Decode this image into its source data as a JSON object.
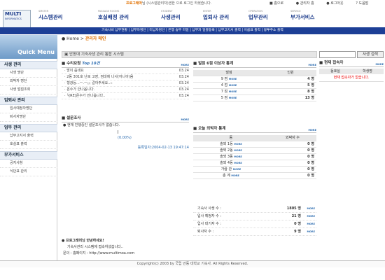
{
  "header": {
    "welcome_name": "프로그래머",
    "welcome_text": "님 (시스템관리자)권한 으로 로그인 하셨습니다.",
    "links": [
      "홈으로",
      "관리자 홈",
      "로그아웃",
      "도움말"
    ],
    "logo_text": "MULTI",
    "logo_sub": "INFORMATICS",
    "nav": [
      {
        "en": "SMSTER",
        "ko": "시스템관리"
      },
      {
        "en": "PASSAGE ROOMS",
        "ko": "호실배정 관리"
      },
      {
        "en": "STUDENT",
        "ko": "사생관리"
      },
      {
        "en": "ENTER",
        "ko": "입퇴사 관리"
      },
      {
        "en": "OPERATION",
        "ko": "업무관리"
      },
      {
        "en": "SERVICE",
        "ko": "부가서비스"
      }
    ],
    "subnav": "기숙사비 납부현황 | 납부자명단 | 미납자명단 | 은행 송부 파일 | 납부자 일괄등록 | 납부고지서 출력 | 이름표 출력 | 봉투주소 출력"
  },
  "sidebar": {
    "title": "Quick Menu",
    "sections": [
      {
        "title": "사생 관리",
        "items": [
          "사생 명단",
          "외박자 명단",
          "사생 벌점조회"
        ]
      },
      {
        "title": "입퇴사 관리",
        "items": [
          "입사예정자명단",
          "퇴사자명단"
        ]
      },
      {
        "title": "업무 관리",
        "items": [
          "납부고지서 출력",
          "호실표 출력"
        ]
      },
      {
        "title": "부가서비스",
        "items": [
          "공지사항",
          "식단표 관리"
        ]
      }
    ]
  },
  "breadcrumb": {
    "home": "Home",
    "sep": ">",
    "current": "관리자 메인"
  },
  "system_title": "안동대 기숙사생 관리 통합 시스템",
  "requests": {
    "title": "수리요청",
    "badge": "Top 10건",
    "more": "MORE",
    "items": [
      {
        "text": "방이 춥네요",
        "date": "03.24"
      },
      {
        "text": "2동 301호 난로 고장, 점대에 나사(어니아)음",
        "date": "03.24"
      },
      {
        "text": "형광등...ㅡ.ㅡ;;; 갈아주세요..::",
        "date": "03.24"
      },
      {
        "text": "온수가 안나옵니다.",
        "date": "03.24"
      },
      {
        "text": "└[RE]온수가 안나옵니다..",
        "date": "03.24"
      }
    ]
  },
  "penalty": {
    "title": "벌점 6점 이상자 통계",
    "more": "MORE",
    "headers": [
      "벌점",
      "인원"
    ],
    "rows": [
      {
        "label": "9 점",
        "count": "4 명"
      },
      {
        "label": "4 점",
        "count": "5 명"
      },
      {
        "label": "7 점",
        "count": "8 명"
      },
      {
        "label": "5 점",
        "count": "13 명"
      }
    ]
  },
  "survey": {
    "title": "설문조사",
    "more": "MORE",
    "question": "현재 진행중인 설문조사가 없습니다.",
    "progress": 0,
    "percent_text": "(0.00%)",
    "date": "등록일자:2004-02-13 19:47:14"
  },
  "outings": {
    "title": "오늘 외박자 통계",
    "more": "MORE",
    "headers": [
      "동",
      "외박자 수"
    ],
    "rows": [
      {
        "label": "솔뫼 1동",
        "count": "0 명"
      },
      {
        "label": "솔뫼 2동",
        "count": "0 명"
      },
      {
        "label": "솔뫼 3동",
        "count": "0 명"
      },
      {
        "label": "솔뫼 4동",
        "count": "0 명"
      },
      {
        "label": "가람 관",
        "count": "0 명"
      },
      {
        "label": "총  계",
        "count": "0 명"
      }
    ]
  },
  "summary": {
    "rows": [
      {
        "label": "기숙사 사생 수 :",
        "value": "1805 명"
      },
      {
        "label": "입사 예정자 수 :",
        "value": "21 명"
      },
      {
        "label": "입사 대기자 수 :",
        "value": "0 명"
      },
      {
        "label": "퇴사자 수 :",
        "value": "9 명"
      }
    ],
    "more": "MORE"
  },
  "notice": {
    "title": "프로그래머님 안녕하세요!",
    "line1": "기숙사관리 시스템에 접속하셨습니다..",
    "line2": "문의 : 홈페이지 : http://www.multimoa.com"
  },
  "search": {
    "placeholder": "",
    "button": "사생 검색"
  },
  "online": {
    "title": "현재 접속자",
    "more": "MORE",
    "headers": [
      "동호실",
      "학생명"
    ],
    "empty": "현재 접속자가 없습니다."
  },
  "footer": "Copyright(c) 2003 by 국립 안동 대학교 기숙사. All Rights Reserved.",
  "colors": {
    "nav_blue": "#1d3f96",
    "accent": "#e07000",
    "link": "#2c6cb0"
  }
}
